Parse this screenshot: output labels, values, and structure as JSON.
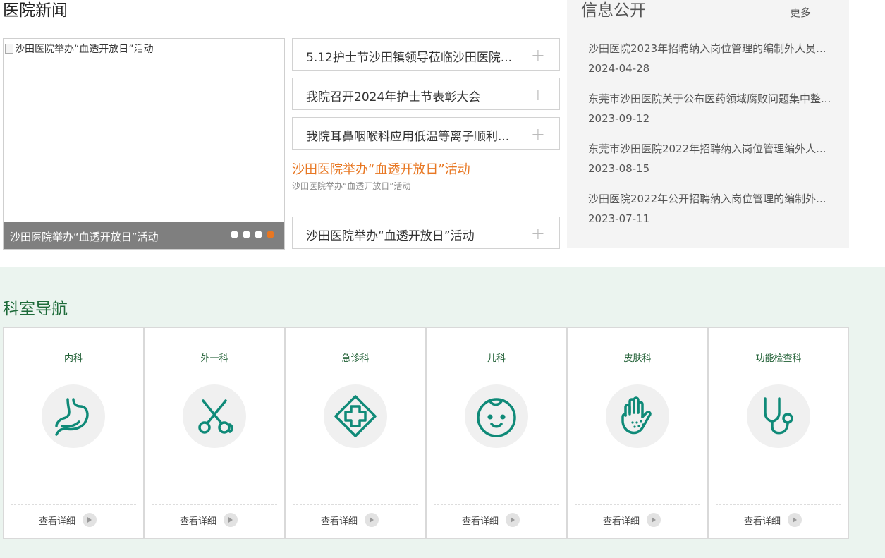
{
  "news": {
    "title": "医院新闻",
    "carousel": {
      "image_alt": "沙田医院举办“血透开放日”活动",
      "caption": "沙田医院举办“血透开放日”活动",
      "dots": 4,
      "active_dot": 4,
      "accent": "#e87722"
    },
    "items": [
      "5.12护士节沙田镇领导莅临沙田医院...",
      "我院召开2024年护士节表彰大会",
      "我院耳鼻咽喉科应用低温等离子顺利..."
    ],
    "featured": {
      "title": "沙田医院举办“血透开放日”活动",
      "subtitle": "沙田医院举办“血透开放日”活动"
    },
    "last_item": "沙田医院举办“血透开放日”活动"
  },
  "info": {
    "title": "信息公开",
    "more": "更多",
    "items": [
      {
        "title": "沙田医院2023年招聘纳入岗位管理的编制外人员...",
        "date": "2024-04-28"
      },
      {
        "title": "东莞市沙田医院关于公布医药领域腐败问题集中整...",
        "date": "2023-09-12"
      },
      {
        "title": "东莞市沙田医院2022年招聘纳入岗位管理编外人...",
        "date": "2023-08-15"
      },
      {
        "title": "沙田医院2022年公开招聘纳入岗位管理的编制外...",
        "date": "2023-07-11"
      }
    ]
  },
  "departments": {
    "title": "科室导航",
    "icon_color": "#0f8a78",
    "items": [
      {
        "name": "内科",
        "icon": "stomach-icon",
        "more": "查看详细"
      },
      {
        "name": "外一科",
        "icon": "scissors-icon",
        "more": "查看详细"
      },
      {
        "name": "急诊科",
        "icon": "medical-cross-icon",
        "more": "查看详细"
      },
      {
        "name": "儿科",
        "icon": "baby-face-icon",
        "more": "查看详细"
      },
      {
        "name": "皮肤科",
        "icon": "hand-skin-icon",
        "more": "查看详细"
      },
      {
        "name": "功能检查科",
        "icon": "stethoscope-icon",
        "more": "查看详细"
      }
    ]
  }
}
